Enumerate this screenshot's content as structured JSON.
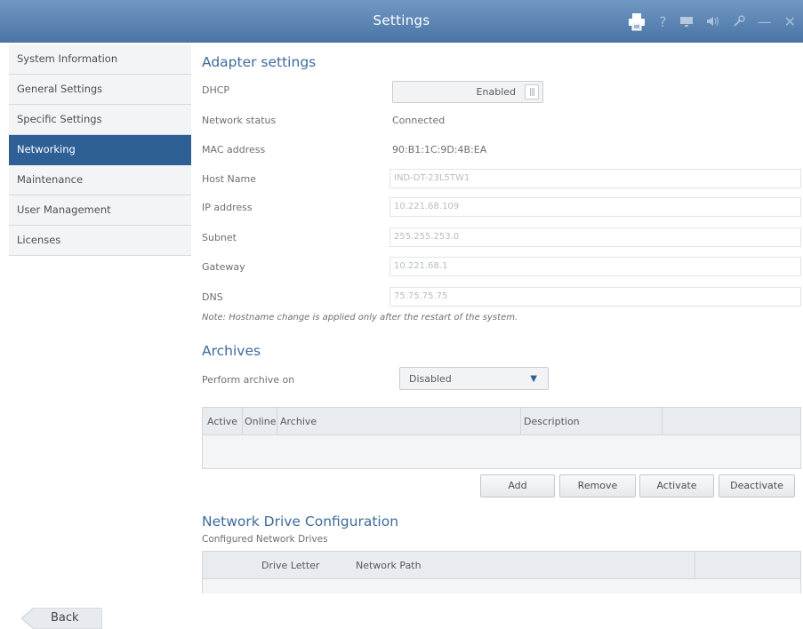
{
  "window": {
    "title": "Settings",
    "icons": [
      "printer-icon",
      "help-icon",
      "monitor-icon",
      "speaker-icon",
      "wrench-icon",
      "minimize-icon",
      "close-icon"
    ]
  },
  "sidebar": {
    "items": [
      {
        "label": "System Information",
        "active": false
      },
      {
        "label": "General Settings",
        "active": false
      },
      {
        "label": "Specific Settings",
        "active": false
      },
      {
        "label": "Networking",
        "active": true
      },
      {
        "label": "Maintenance",
        "active": false
      },
      {
        "label": "User Management",
        "active": false
      },
      {
        "label": "Licenses",
        "active": false
      }
    ]
  },
  "adapter": {
    "title": "Adapter settings",
    "dhcp_label": "DHCP",
    "dhcp_value": "Enabled",
    "network_status_label": "Network status",
    "network_status_value": "Connected",
    "mac_label": "MAC address",
    "mac_value": "90:B1:1C:9D:4B:EA",
    "host_label": "Host Name",
    "host_value": "IND-DT-23L5TW1",
    "ip_label": "IP address",
    "ip_value": "10.221.68.109",
    "subnet_label": "Subnet",
    "subnet_value": "255.255.253.0",
    "gateway_label": "Gateway",
    "gateway_value": "10.221.68.1",
    "dns_label": "DNS",
    "dns_value": "75.75.75.75",
    "note": "Note: Hostname change is applied only after the restart of the system."
  },
  "archives": {
    "title": "Archives",
    "perform_label": "Perform archive on",
    "perform_value": "Disabled",
    "columns": [
      "Active",
      "Online",
      "Archive",
      "Description"
    ],
    "buttons": {
      "add": "Add",
      "remove": "Remove",
      "activate": "Activate",
      "deactivate": "Deactivate"
    }
  },
  "network_drive": {
    "title": "Network Drive Configuration",
    "subtitle": "Configured Network Drives",
    "columns": [
      "Drive Letter",
      "Network Path"
    ]
  },
  "footer": {
    "back_label": "Back"
  },
  "colors": {
    "titlebar": "#5a84b4",
    "sidebar_active": "#2e5f95",
    "section_title": "#3e6a9c"
  }
}
